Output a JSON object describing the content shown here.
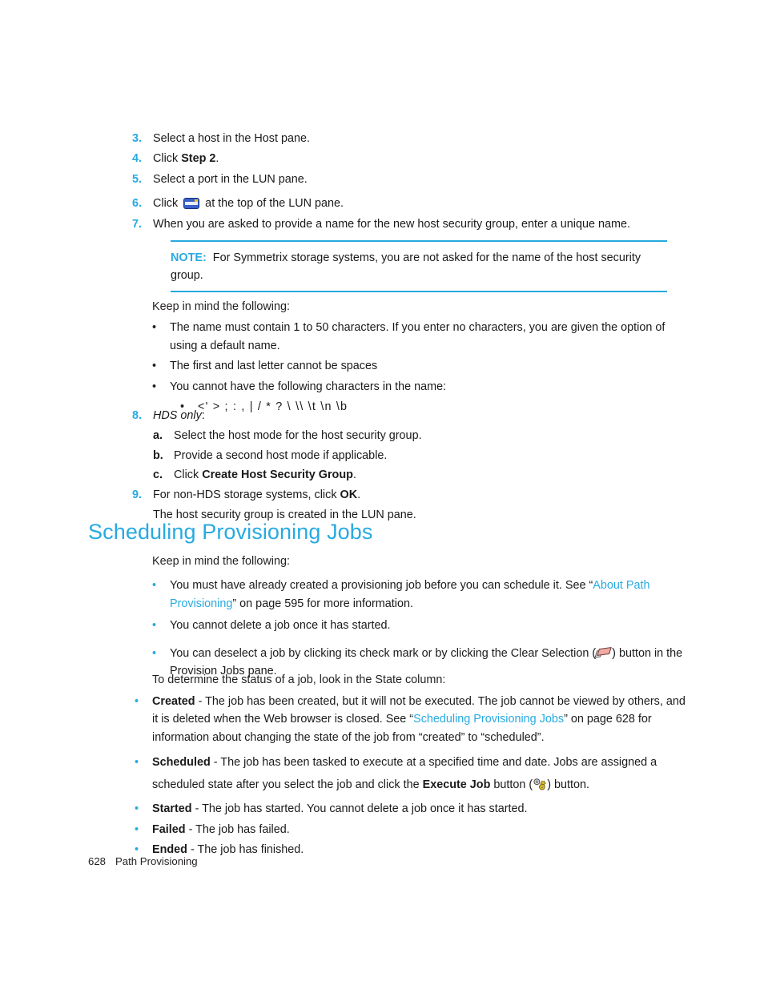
{
  "document": {
    "footer": {
      "page_number": "628",
      "section": "Path Provisioning"
    },
    "heading": "Scheduling Provisioning Jobs",
    "steps": [
      {
        "num": "3.",
        "text_before": "Select a host in the Host pane.",
        "bold": "",
        "text_after": ""
      },
      {
        "num": "4.",
        "text_before": "Click ",
        "bold": "Step 2",
        "text_after": "."
      },
      {
        "num": "5.",
        "text_before": "Select a port in the LUN pane.",
        "bold": "",
        "text_after": ""
      },
      {
        "num": "6.",
        "text_before": "Click ",
        "bold": "",
        "text_after": " at the top of the LUN pane.",
        "icon": "lun-pane-icon"
      },
      {
        "num": "7.",
        "text_before": "When you are asked to provide a name for the new host security group, enter a unique name.",
        "bold": "",
        "text_after": ""
      }
    ],
    "note": {
      "label": "NOTE:",
      "text": "For Symmetrix storage systems, you are not asked for the name of the host security group."
    },
    "keep_in_mind_1": {
      "intro": "Keep in mind the following:",
      "bullets": [
        "The name must contain 1 to 50 characters. If you enter no characters, you are given the option of using a default name.",
        "The first and last letter cannot be spaces",
        "You cannot have the following characters in the name:"
      ],
      "sub_bullet": "<' > ; : , | / * ? \\ \\\\ \\t \\n \\b"
    },
    "step8": {
      "num": "8.",
      "label": "HDS only",
      "colon": ":",
      "substeps": [
        {
          "letter": "a.",
          "text_before": "Select the host mode for the host security group.",
          "bold": "",
          "text_after": ""
        },
        {
          "letter": "b.",
          "text_before": "Provide a second host mode if applicable.",
          "bold": "",
          "text_after": ""
        },
        {
          "letter": "c.",
          "text_before": "Click ",
          "bold": "Create Host Security Group",
          "text_after": "."
        }
      ]
    },
    "step9": {
      "num": "9.",
      "text_before": "For non-HDS storage systems, click ",
      "bold": "OK",
      "text_after": ".",
      "follow_up": "The host security group is created in the LUN pane."
    },
    "keep_in_mind_2": {
      "intro": "Keep in mind the following:",
      "bullet1": {
        "part1": "You must have already created a provisioning job before you can schedule it. See “",
        "link": "About Path Provisioning",
        "part2": "” on page 595 for more information."
      },
      "bullet2": "You cannot delete a job once it has started.",
      "bullet3": {
        "part1": "You can deselect a job by clicking its check mark or by clicking the Clear Selection (",
        "icon": "eraser-icon",
        "part2": ") button in the Provision Jobs pane."
      }
    },
    "state_intro": "To determine the status of a job, look in the State column:",
    "states": [
      {
        "name": "Created",
        "part1": " - The job has been created, but it will not be executed. The job cannot be viewed by others, and it is deleted when the Web browser is closed. See “",
        "link": "Scheduling Provisioning Jobs",
        "part2": "” on page 628 for information about changing the state of the job from “created” to “scheduled”."
      },
      {
        "name": "Scheduled",
        "part1": " - The job has been tasked to execute at a specified time and date. Jobs are assigned a scheduled state after you select the job and click the ",
        "bold2": "Execute Job",
        "part2": " button (",
        "icon": "execute-job-gear-icon",
        "part3": ") button."
      },
      {
        "name": "Started",
        "part1": " - The job has started. You cannot delete a job once it has started."
      },
      {
        "name": "Failed",
        "part1": " - The job has failed."
      },
      {
        "name": "Ended",
        "part1": " - The job has finished."
      }
    ],
    "colors": {
      "accent_cyan": "#27aae1",
      "body_text": "#231f20",
      "icon_blue": "#3a5fc8",
      "icon_eraser_pink": "#f0a9a3",
      "icon_gear_gold": "#e6c32b"
    }
  }
}
